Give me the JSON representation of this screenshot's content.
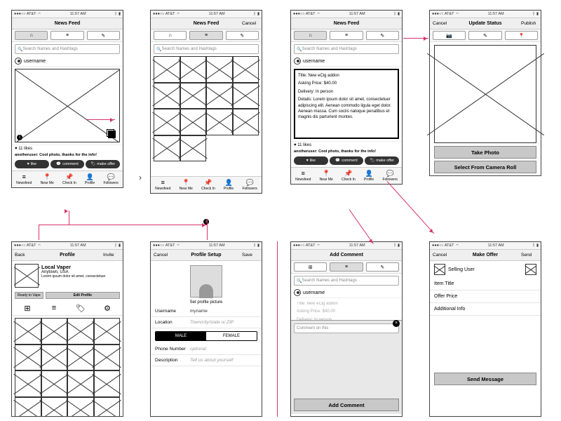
{
  "status": {
    "carrier": "●●●○○ AT&T",
    "wifi": "⌔",
    "time": "11:57 AM",
    "bt": "ᛒ",
    "batt": "▮"
  },
  "newsfeed": {
    "title": "News Feed",
    "cancel": "Cancel",
    "search": "Search Names and Hashtags",
    "username": "username",
    "likes": "11 likes",
    "comment": "anotheruser: Cool photo, thanks for the info!",
    "like_btn": "like",
    "comment_btn": "comment",
    "offer_btn": "make offer",
    "tabs": [
      "Newsfeed",
      "Near Me",
      "Check In",
      "Profile",
      "Followers"
    ]
  },
  "details": {
    "title": "Title: New eCig addon",
    "price": "Asking Price: $40.00",
    "delivery": "Delivery: In person",
    "body": "Details: Lorem ipsum dolor sit amet, consectetuer adipiscing elit. Aenean commodo ligula eget dolor. Aenean massa. Cum sociis natoque penatibus et magnis dis parturient montes."
  },
  "update": {
    "title": "Update Status",
    "cancel": "Cancel",
    "publish": "Publish",
    "take": "Take Photo",
    "roll": "Select From Camera Roll"
  },
  "profile": {
    "title": "Profile",
    "back": "Back",
    "invite": "Invite",
    "name": "Local Vaper",
    "loc": "Anytown, USA",
    "desc": "Lorem ipsum dolor sit amet, consectetuer",
    "badge": "Ready to Vape",
    "edit": "Edit Profile"
  },
  "setup": {
    "title": "Profile Setup",
    "cancel": "Cancel",
    "save": "Save",
    "setpic": "Set profile picture",
    "fields": {
      "username": "Username",
      "location": "Location",
      "phone": "Phone Number",
      "desc": "Description"
    },
    "vals": {
      "username": "myname",
      "location": "Town/city/state or ZIP",
      "phone": "optional",
      "desc": "Tell us about yourself"
    },
    "male": "MALE",
    "female": "FEMALE"
  },
  "addcomment": {
    "title": "Add Comment",
    "placeholder": "Comment on this",
    "btn": "Add Comment"
  },
  "makeoffer": {
    "title": "Make Offer",
    "cancel": "Cancel",
    "send": "Send",
    "seller": "Selling User",
    "item": "Item Title",
    "price": "Offer Price",
    "info": "Additional Info",
    "sendmsg": "Send Message"
  }
}
